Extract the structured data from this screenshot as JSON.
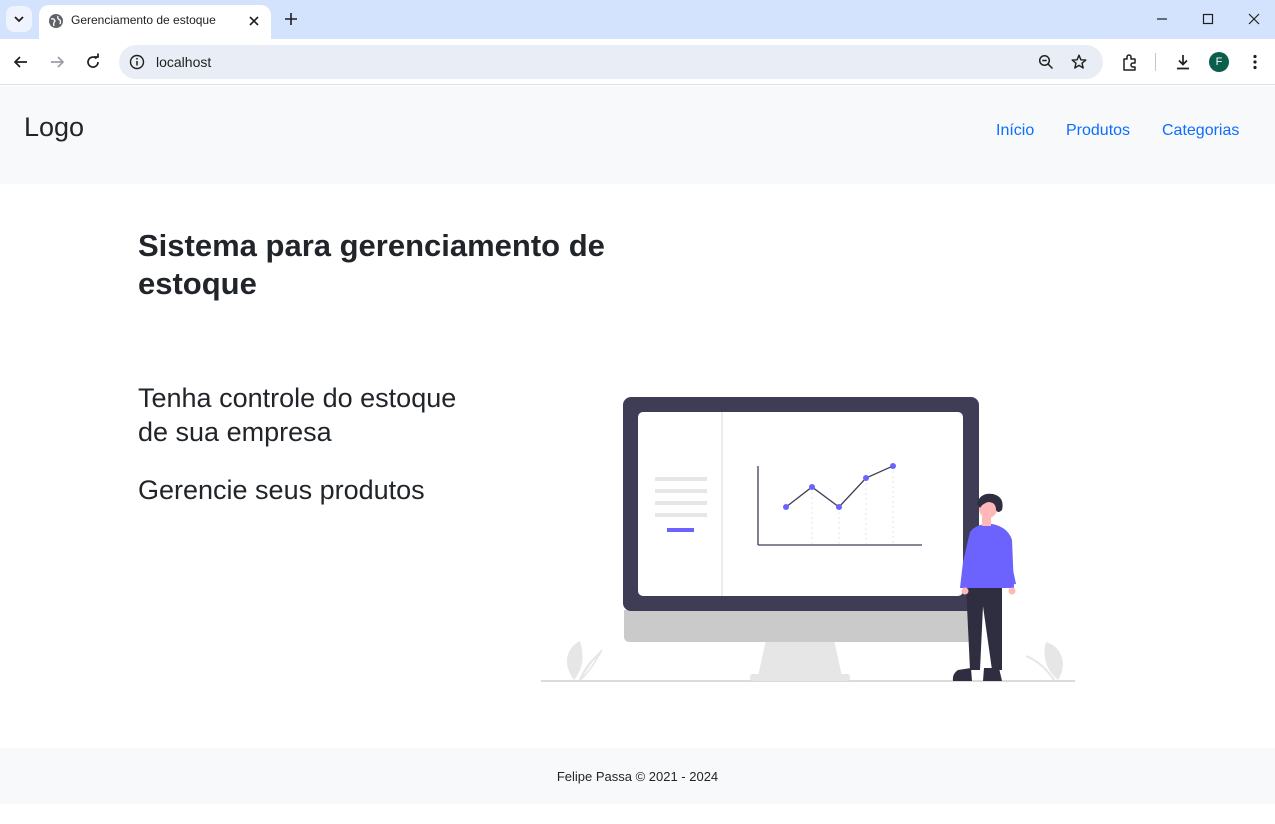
{
  "browser": {
    "tab_title": "Gerenciamento de estoque",
    "url": "localhost",
    "profile_initial": "F"
  },
  "header": {
    "logo": "Logo",
    "nav": [
      {
        "label": "Início"
      },
      {
        "label": "Produtos"
      },
      {
        "label": "Categorias"
      }
    ]
  },
  "main": {
    "title": "Sistema para gerenciamento de estoque",
    "subtitles": [
      "Tenha controle do estoque de sua empresa",
      "Gerencie seus produtos"
    ]
  },
  "footer": {
    "text": "Felipe Passa © 2021 - 2024"
  },
  "colors": {
    "link": "#0d6efd",
    "header_bg": "#f8f9fa",
    "accent": "#6c63ff",
    "monitor_frame": "#3f3d56"
  },
  "icons": [
    "tab-search-icon",
    "globe-icon",
    "close-icon",
    "plus-icon",
    "minimize-icon",
    "maximize-icon",
    "window-close-icon",
    "back-arrow-icon",
    "forward-arrow-icon",
    "reload-icon",
    "info-icon",
    "zoom-icon",
    "star-icon",
    "extensions-icon",
    "download-icon",
    "menu-dots-icon"
  ]
}
